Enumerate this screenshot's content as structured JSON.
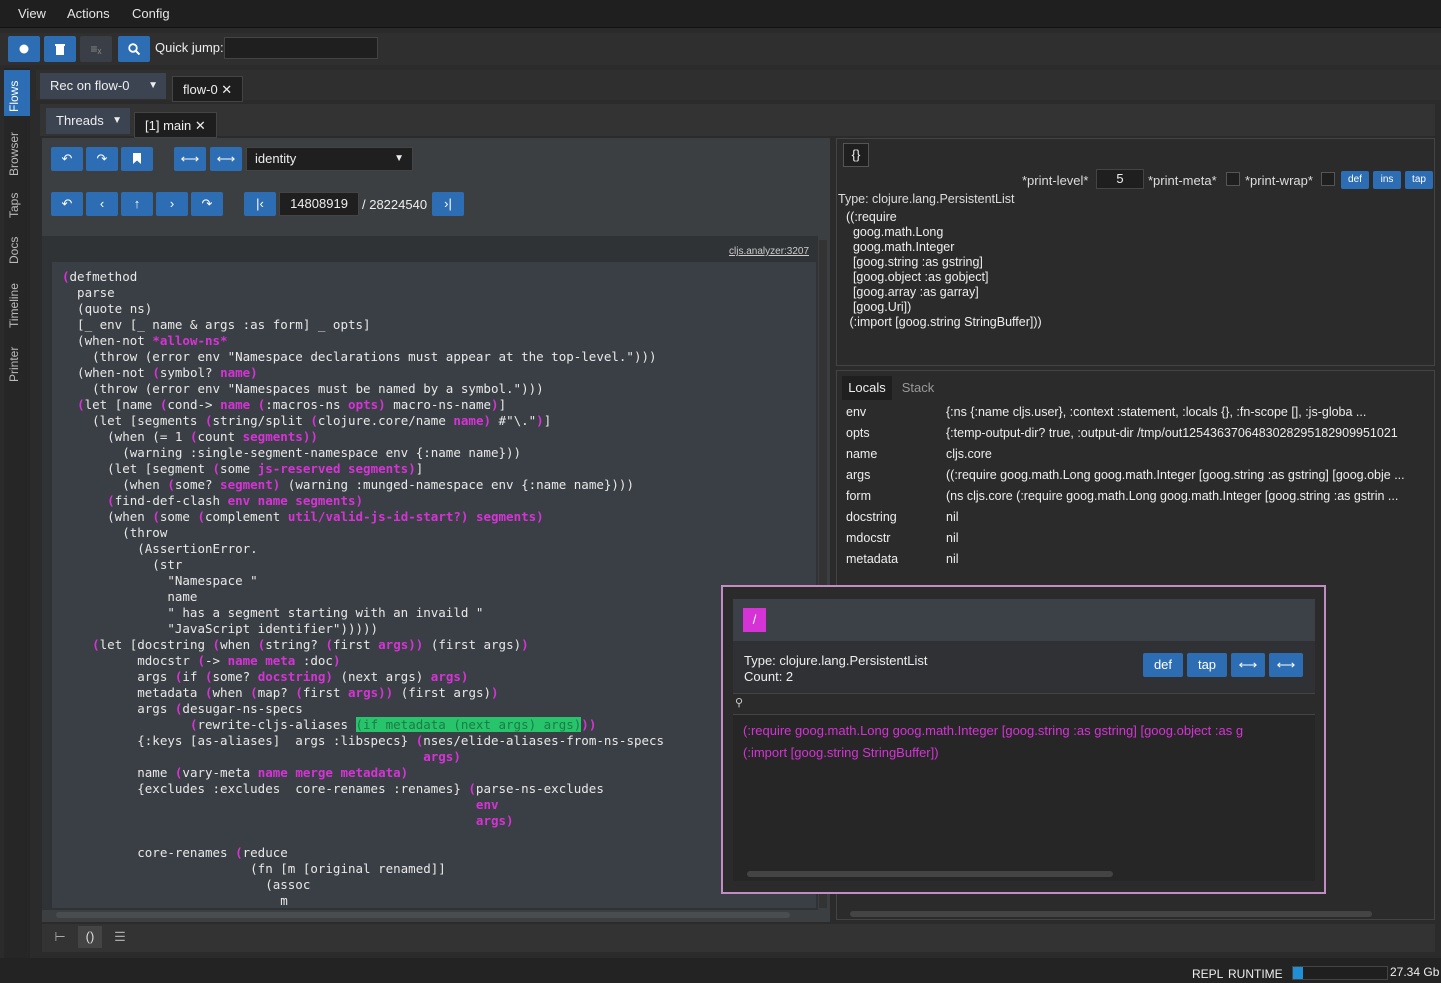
{
  "menu": [
    "View",
    "Actions",
    "Config"
  ],
  "toolbar": {
    "quick_jump_label": "Quick jump:",
    "quick_jump_value": ""
  },
  "side_tabs": [
    "Flows",
    "Browser",
    "Taps",
    "Docs",
    "Timeline",
    "Printer"
  ],
  "flow_tabs": {
    "rec_label": "Rec on flow-0",
    "open_tab": "flow-0 ✕"
  },
  "thread_tabs": {
    "threads_label": "Threads",
    "open_tab": "[1] main ✕"
  },
  "navigation": {
    "fn_select": "identity",
    "step_current": "14808919",
    "step_total": "/ 28224540"
  },
  "code": {
    "source_ref": "cljs.analyzer:3207"
  },
  "value_panel": {
    "open_brackets_btn": "{}",
    "print_level_label": "*print-level*",
    "print_level_value": "5",
    "print_meta_label": "*print-meta*",
    "print_wrap_label": "*print-wrap*",
    "btn_def": "def",
    "btn_ins": "ins",
    "btn_tap": "tap",
    "type_line": "Type: clojure.lang.PersistentList",
    "value_lines": [
      "((:require",
      "  goog.math.Long",
      "  goog.math.Integer",
      "  [goog.string :as gstring]",
      "  [goog.object :as gobject]",
      "  [goog.array :as garray]",
      "  [goog.Uri])",
      " (:import [goog.string StringBuffer]))"
    ]
  },
  "locals": {
    "tab_locals": "Locals",
    "tab_stack": "Stack",
    "rows": [
      {
        "k": "env",
        "v": "{:ns {:name cljs.user}, :context :statement, :locals {}, :fn-scope [], :js-globa ..."
      },
      {
        "k": "opts",
        "v": "{:temp-output-dir? true, :output-dir /tmp/out1254363706483028295182909951021"
      },
      {
        "k": "name",
        "v": "cljs.core"
      },
      {
        "k": "args",
        "v": "((:require goog.math.Long goog.math.Integer [goog.string :as gstring] [goog.obje ..."
      },
      {
        "k": "form",
        "v": "(ns cljs.core (:require goog.math.Long goog.math.Integer [goog.string :as gstrin ..."
      },
      {
        "k": "docstring",
        "v": "nil"
      },
      {
        "k": "mdocstr",
        "v": "nil"
      },
      {
        "k": "metadata",
        "v": "nil"
      }
    ]
  },
  "overlay": {
    "root_btn": "/",
    "type_line": "Type: clojure.lang.PersistentList",
    "count_line": "Count: 2",
    "btn_def": "def",
    "btn_tap": "tap",
    "item1": "(:require goog.math.Long goog.math.Integer [goog.string :as gstring] [goog.object :as g",
    "item2": "(:import [goog.string StringBuffer])"
  },
  "status": {
    "repl_label": "REPL",
    "runtime_label": "RUNTIME",
    "memory": "27.34 Gb"
  },
  "colors": {
    "accent": "#2d6db3",
    "highlight_keyword": "#d633d6",
    "highlight_expr": "#27c46c"
  }
}
